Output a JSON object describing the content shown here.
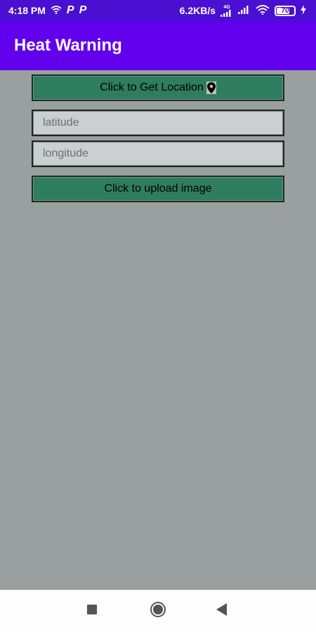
{
  "status_bar": {
    "time": "4:18 PM",
    "p_icon_1": "P",
    "p_icon_2": "P",
    "network_speed": "6.2KB/s",
    "signal_label": "4G",
    "battery": "70"
  },
  "app_bar": {
    "title": "Heat Warning",
    "bg_color": "#6200ee"
  },
  "main": {
    "get_location_label": "Click to Get Location",
    "latitude_placeholder": "latitude",
    "longitude_placeholder": "longitude",
    "upload_label": "Click to upload image",
    "button_color": "#2e7d5f"
  },
  "icons": {
    "location": "location-pin-icon",
    "recent": "square-icon",
    "home": "circle-icon",
    "back": "triangle-back-icon"
  }
}
